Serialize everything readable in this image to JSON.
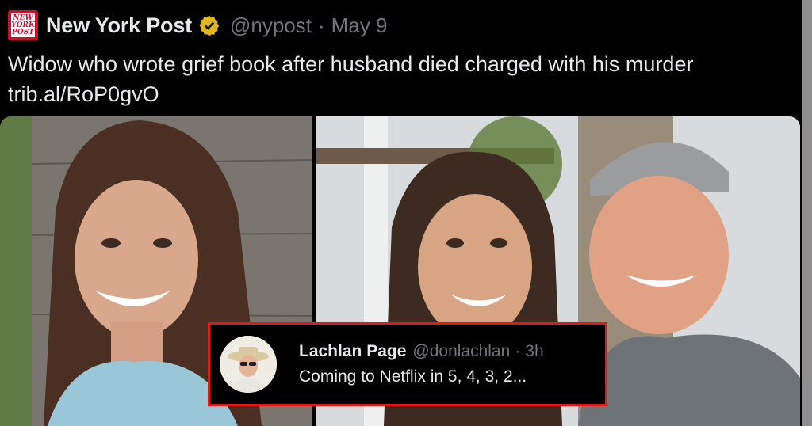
{
  "post": {
    "logo_text": [
      "NEW",
      "YORK",
      "POST"
    ],
    "author_name": "New York Post",
    "handle": "@nypost",
    "separator": "·",
    "date": "May 9",
    "text": "Widow who wrote grief book after husband died charged with his murder trib.al/RoP0gvO"
  },
  "reply": {
    "author_name": "Lachlan Page",
    "handle": "@donlachlan",
    "separator": "·",
    "time": "3h",
    "text": "Coming to Netflix in 5, 4, 3, 2..."
  },
  "colors": {
    "background": "#000000",
    "text": "#e7e9ea",
    "muted": "#71767b",
    "verified_gold": "#e2b719",
    "logo_red": "#c8102e",
    "highlight_border": "#e0191b"
  }
}
